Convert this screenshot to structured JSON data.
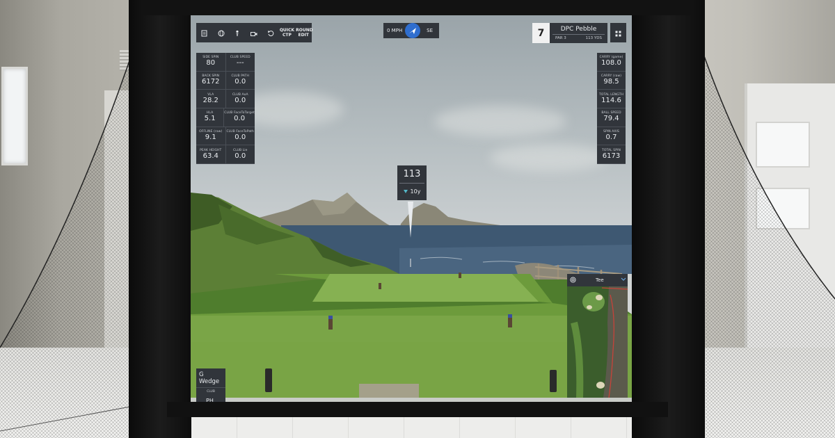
{
  "toolbar": {
    "buttons": [
      {
        "name": "scorecard-icon"
      },
      {
        "name": "globe-icon"
      },
      {
        "name": "tee-icon"
      },
      {
        "name": "camera-icon"
      },
      {
        "name": "undo-icon"
      }
    ],
    "quick_ctp_line1": "QUICK",
    "quick_ctp_line2": "CTP",
    "round_edit_line1": "ROUND",
    "round_edit_line2": "EDIT"
  },
  "wind": {
    "speed": "0 MPH",
    "direction": "SE"
  },
  "hole": {
    "number": "7",
    "course": "DPC Pebble",
    "par": "PAR 3",
    "yards": "113 YDS"
  },
  "stats_left": [
    [
      {
        "label": "SIDE SPIN",
        "value": "80"
      },
      {
        "label": "CLUB SPEED",
        "value": "---"
      }
    ],
    [
      {
        "label": "BACK SPIN",
        "value": "6172"
      },
      {
        "label": "CLUB PATH",
        "value": "0.0"
      }
    ],
    [
      {
        "label": "VLA",
        "value": "28.2"
      },
      {
        "label": "CLUB AoA",
        "value": "0.0"
      }
    ],
    [
      {
        "label": "HLA",
        "value": "5.1"
      },
      {
        "label": "CLUB FaceToTarget",
        "value": "0.0"
      }
    ],
    [
      {
        "label": "OFFLINE (raw)",
        "value": "9.1"
      },
      {
        "label": "CLUB FaceToPath",
        "value": "0.0"
      }
    ],
    [
      {
        "label": "PEAK HEIGHT",
        "value": "63.4"
      },
      {
        "label": "CLUB Lie",
        "value": "0.0"
      }
    ]
  ],
  "stats_right": [
    {
      "label": "CARRY (game)",
      "value": "108.0"
    },
    {
      "label": "CARRY (raw)",
      "value": "98.5"
    },
    {
      "label": "TOTAL LENGTH",
      "value": "114.6"
    },
    {
      "label": "BALL SPEED",
      "value": "79.4"
    },
    {
      "label": "SPIN AXIS",
      "value": "0.7"
    },
    {
      "label": "TOTAL SPIN",
      "value": "6173"
    }
  ],
  "flag": {
    "distance": "113",
    "elevation": "10y"
  },
  "club": {
    "name": "G Wedge",
    "label": "CLUB",
    "short": "PH"
  },
  "minimap": {
    "title": "Tee"
  },
  "colors": {
    "panel": "#31353b",
    "wind_arrow": "#2f6ecf",
    "fairway": "#7fb04a",
    "ocean": "#3e5872"
  }
}
